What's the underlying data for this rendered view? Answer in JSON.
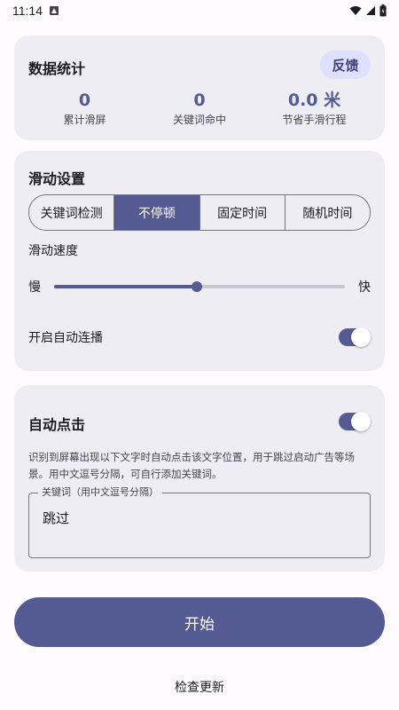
{
  "status_bar": {
    "time": "11:14"
  },
  "stats": {
    "title": "数据统计",
    "feedback_label": "反馈",
    "items": [
      {
        "value": "0",
        "label": "累计滑屏"
      },
      {
        "value": "0",
        "label": "关键词命中"
      },
      {
        "value": "0.0 米",
        "label": "节省手滑行程"
      }
    ]
  },
  "slide_settings": {
    "title": "滑动设置",
    "modes": [
      "关键词检测",
      "不停顿",
      "固定时间",
      "随机时间"
    ],
    "active_mode": "不停顿",
    "speed_label": "滑动速度",
    "speed_slow": "慢",
    "speed_fast": "快",
    "speed_value": 0.49,
    "auto_continue_label": "开启自动连播",
    "auto_continue_on": true
  },
  "auto_click": {
    "title": "自动点击",
    "enabled": true,
    "description": "识别到屏幕出现以下文字时自动点击该文字位置，用于跳过启动广告等场景。用中文逗号分隔，可自行添加关键词。",
    "keyword_label": "关键词（用中文逗号分隔）",
    "keyword_value": "跳过"
  },
  "start_label": "开始",
  "check_update_label": "检查更新",
  "colors": {
    "primary": "#545a92",
    "surface": "#efedf4",
    "background": "#fefbff",
    "tonal": "#dfe0ff"
  }
}
